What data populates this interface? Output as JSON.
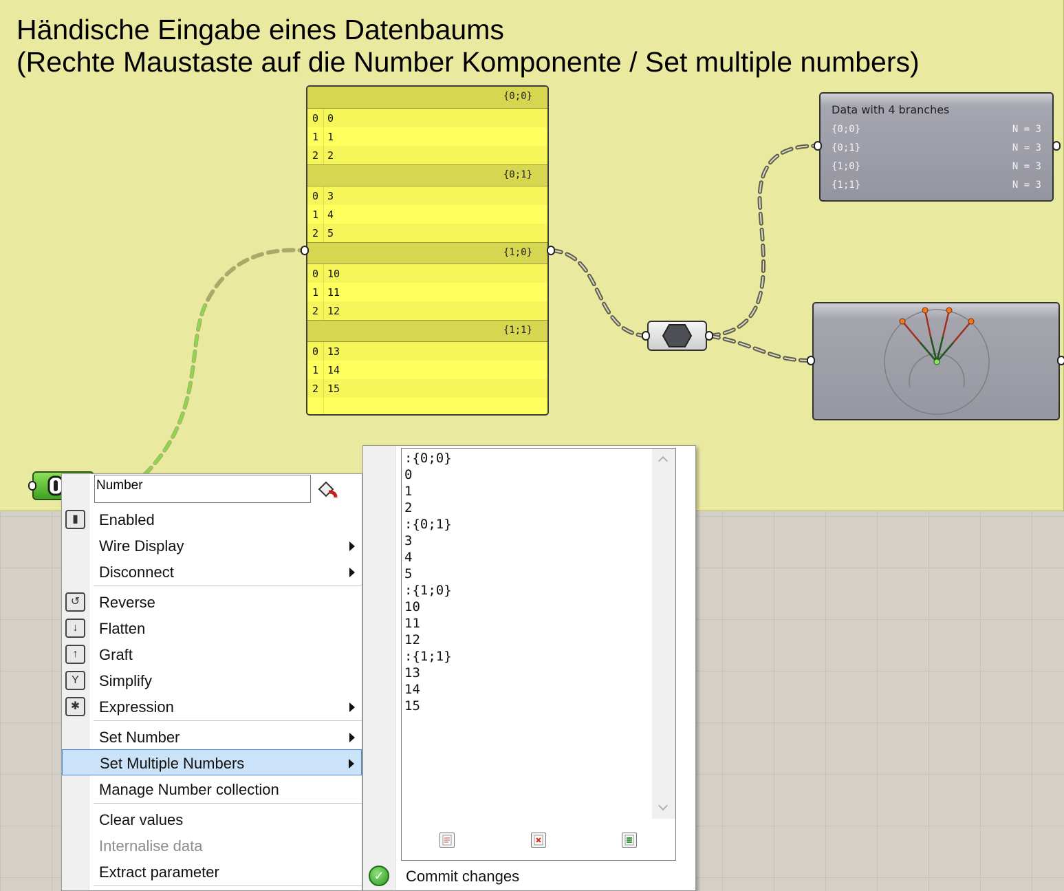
{
  "title": {
    "line1": "Händische Eingabe eines Datenbaums",
    "line2": "(Rechte Maustaste auf die Number Komponente / Set multiple numbers)"
  },
  "panel": {
    "branches": [
      {
        "path": "{0;0}",
        "items": [
          {
            "i": "0",
            "v": "0"
          },
          {
            "i": "1",
            "v": "1"
          },
          {
            "i": "2",
            "v": "2"
          }
        ]
      },
      {
        "path": "{0;1}",
        "items": [
          {
            "i": "0",
            "v": "3"
          },
          {
            "i": "1",
            "v": "4"
          },
          {
            "i": "2",
            "v": "5"
          }
        ]
      },
      {
        "path": "{1;0}",
        "items": [
          {
            "i": "0",
            "v": "10"
          },
          {
            "i": "1",
            "v": "11"
          },
          {
            "i": "2",
            "v": "12"
          }
        ]
      },
      {
        "path": "{1;1}",
        "items": [
          {
            "i": "0",
            "v": "13"
          },
          {
            "i": "1",
            "v": "14"
          },
          {
            "i": "2",
            "v": "15"
          }
        ]
      }
    ]
  },
  "viewer": {
    "title": "Data with 4 branches",
    "rows": [
      {
        "path": "{0;0}",
        "count": "N = 3"
      },
      {
        "path": "{0;1}",
        "count": "N = 3"
      },
      {
        "path": "{1;0}",
        "count": "N = 3"
      },
      {
        "path": "{1;1}",
        "count": "N = 3"
      }
    ]
  },
  "menu": {
    "name_value": "Number",
    "items": {
      "enabled": "Enabled",
      "wire_display": "Wire Display",
      "disconnect": "Disconnect",
      "reverse": "Reverse",
      "flatten": "Flatten",
      "graft": "Graft",
      "simplify": "Simplify",
      "expression": "Expression",
      "set_number": "Set Number",
      "set_multiple": "Set Multiple Numbers",
      "manage": "Manage Number collection",
      "clear": "Clear values",
      "internalise": "Internalise data",
      "extract": "Extract parameter"
    }
  },
  "submenu": {
    "editor_lines": [
      ":{0;0}",
      "0",
      "1",
      "2",
      ":{0;1}",
      "3",
      "4",
      "5",
      ":{1;0}",
      "10",
      "11",
      "12",
      ":{1;1}",
      "13",
      "14",
      "15"
    ],
    "commit_label": "Commit changes"
  },
  "colors": {
    "group": "#eae9a0",
    "panel": "#ffff5e",
    "selection": "#cbe3f8",
    "wire": "#5e5e4c",
    "selected_wire": "#8fd64f"
  }
}
